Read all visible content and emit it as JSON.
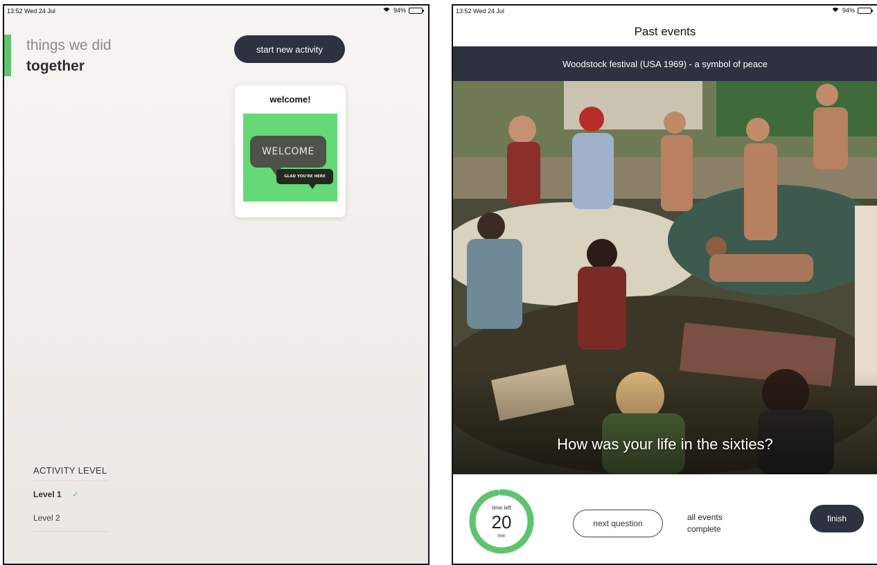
{
  "left_screen": {
    "status_bar": {
      "time": "13:52  Wed 24 Jul",
      "battery": "94%"
    },
    "title_light": "things we did",
    "title_bold": "together",
    "start_button": "start new activity",
    "welcome_card": {
      "title": "welcome!",
      "bubble_main": "WELCOME",
      "bubble_sub": "GLAD YOU'RE HERE"
    },
    "activity_level": {
      "heading": "ACTIVITY LEVEL",
      "levels": [
        {
          "label": "Level 1",
          "selected": true
        },
        {
          "label": "Level 2",
          "selected": false
        }
      ],
      "check_mark": "✓"
    }
  },
  "right_screen": {
    "status_bar": {
      "time": "13:52  Wed 24 Jul",
      "battery": "94%"
    },
    "page_title": "Past events",
    "event_title": "Woodstock festival (USA 1969) - a symbol of peace",
    "question": "How was your life in the sixties?",
    "timer": {
      "label": "time left",
      "value": "20",
      "unit": "min",
      "progress": 0.97
    },
    "next_button": "next question",
    "status_line1": "all events",
    "status_line2": "complete",
    "finish_button": "finish"
  },
  "colors": {
    "accent_green": "#5ec46e",
    "dark_navy": "#2e3140",
    "card_green": "#66d977"
  }
}
